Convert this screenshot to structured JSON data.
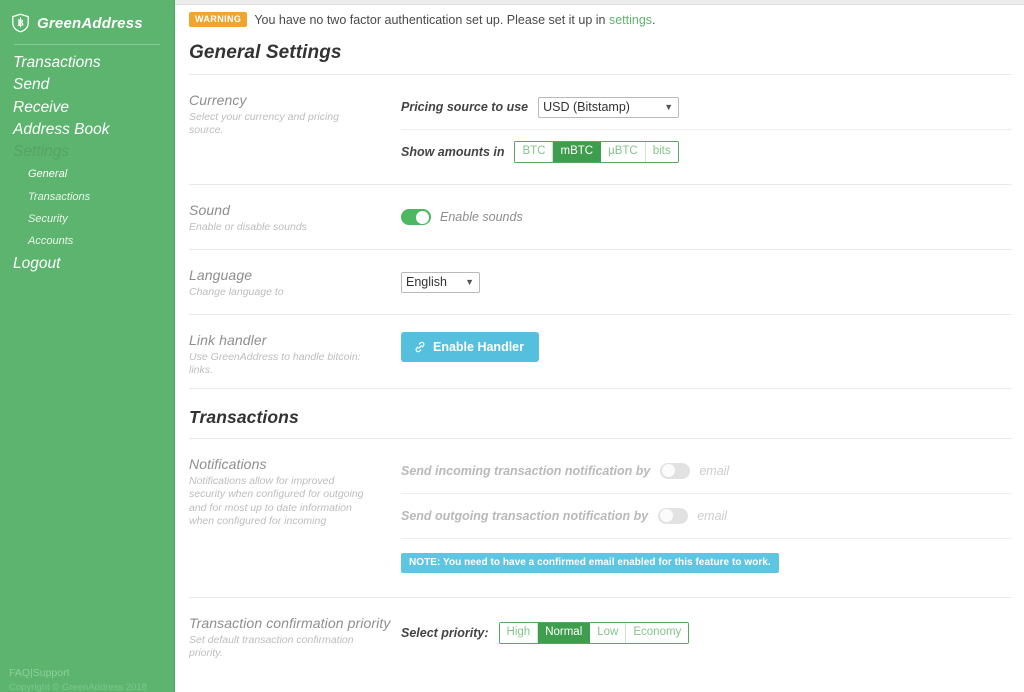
{
  "sidebar": {
    "brand": {
      "name": "GreenAddress",
      "icon": "shield-bitcoin-icon"
    },
    "nav": [
      {
        "label": "Transactions",
        "state": "normal"
      },
      {
        "label": "Send",
        "state": "normal"
      },
      {
        "label": "Receive",
        "state": "normal"
      },
      {
        "label": "Address Book",
        "state": "normal"
      },
      {
        "label": "Settings",
        "state": "muted"
      }
    ],
    "sub_nav": [
      {
        "label": "General",
        "state": "active"
      },
      {
        "label": "Transactions",
        "state": "normal"
      },
      {
        "label": "Security",
        "state": "normal"
      },
      {
        "label": "Accounts",
        "state": "normal"
      }
    ],
    "logout": "Logout",
    "footer": {
      "faq": "FAQ",
      "separator": "|",
      "support": "Support",
      "copyright": "Copyright © GreenAddress 2018"
    },
    "colors": {
      "background": "#5cb46e",
      "muted_text": "#55a365",
      "footer_text": "#8cd09b"
    }
  },
  "warning": {
    "badge": "WARNING",
    "text_before": "You have no two factor authentication set up. Please set it up in ",
    "link": "settings",
    "text_after": ".",
    "badge_color": "#f0a52c",
    "link_color": "#63b36f"
  },
  "page": {
    "title": "General Settings"
  },
  "general": {
    "currency": {
      "label": "Currency",
      "description": "Select your currency and pricing source.",
      "pricing_label": "Pricing source to use",
      "pricing_value": "USD (Bitstamp)",
      "pricing_options": [
        "USD (Bitstamp)"
      ],
      "amounts_label": "Show amounts in",
      "units": [
        {
          "label": "BTC",
          "selected": false
        },
        {
          "label": "mBTC",
          "selected": true
        },
        {
          "label": "µBTC",
          "selected": false
        },
        {
          "label": "bits",
          "selected": false
        }
      ]
    },
    "sound": {
      "label": "Sound",
      "description": "Enable or disable sounds",
      "toggle_label": "Enable sounds",
      "toggle_on": true
    },
    "language": {
      "label": "Language",
      "description": "Change language to",
      "value": "English",
      "options": [
        "English"
      ]
    },
    "link_handler": {
      "label": "Link handler",
      "description": "Use GreenAddress to handle bitcoin: links.",
      "button_label": "Enable Handler",
      "button_icon": "link-icon",
      "button_color": "#54c0de"
    }
  },
  "transactions": {
    "title": "Transactions",
    "notifications": {
      "label": "Notifications",
      "description": "Notifications allow for improved security when configured for outgoing and for most up to date information when configured for incoming",
      "incoming_label": "Send incoming transaction notification by",
      "incoming_channel": "email",
      "incoming_on": false,
      "outgoing_label": "Send outgoing transaction notification by",
      "outgoing_channel": "email",
      "outgoing_on": false,
      "note": "NOTE: You need to have a confirmed email enabled for this feature to work.",
      "note_color": "#5ec6e2"
    },
    "priority": {
      "label": "Transaction confirmation priority",
      "description": "Set default transaction confirmation priority.",
      "select_label": "Select priority:",
      "options": [
        {
          "label": "High",
          "selected": false
        },
        {
          "label": "Normal",
          "selected": true
        },
        {
          "label": "Low",
          "selected": false
        },
        {
          "label": "Economy",
          "selected": false
        }
      ]
    }
  }
}
